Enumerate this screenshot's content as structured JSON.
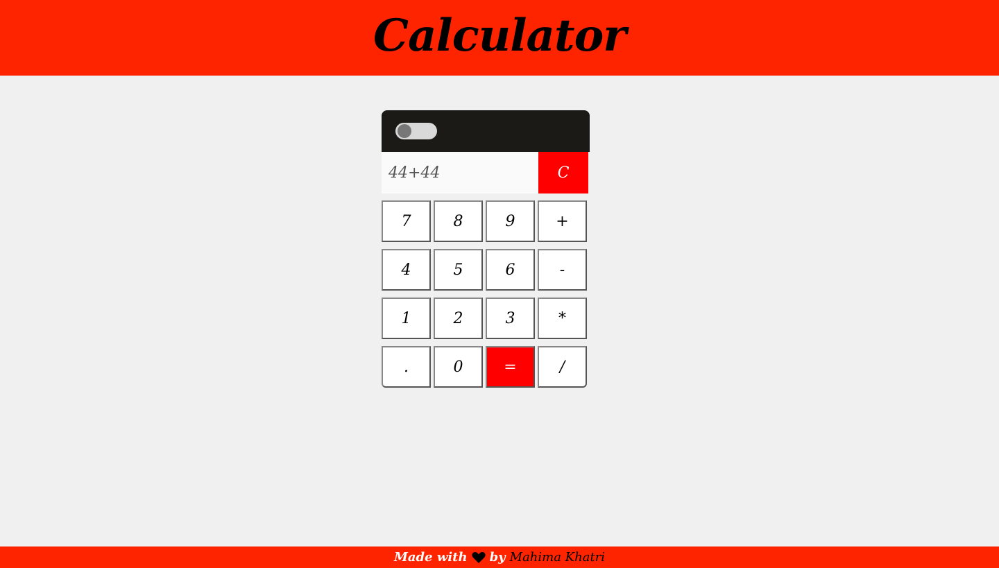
{
  "header": {
    "title": "Calculator"
  },
  "calculator": {
    "display_value": "44+44",
    "clear_label": "C",
    "keys": [
      [
        "7",
        "8",
        "9",
        "+"
      ],
      [
        "4",
        "5",
        "6",
        "-"
      ],
      [
        "1",
        "2",
        "3",
        "*"
      ],
      [
        ".",
        "0",
        "=",
        "/"
      ]
    ]
  },
  "footer": {
    "made_with": "Made with",
    "heart_icon": "heart-icon",
    "by": "by",
    "author": "Mahima Khatri"
  },
  "colors": {
    "header_bg": "#ff2400",
    "accent": "#ff0000",
    "calc_top": "#1c1a17",
    "page_bg": "#f0f0f0"
  }
}
